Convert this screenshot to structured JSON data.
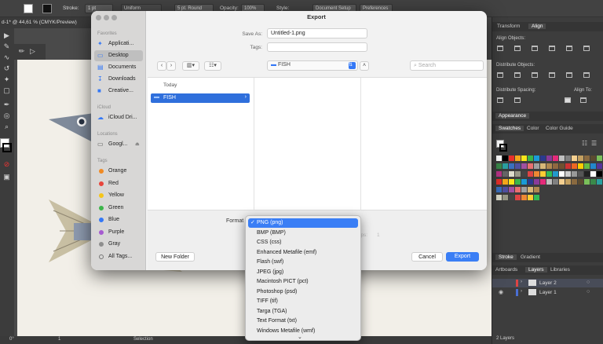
{
  "controlbar": {
    "stroke_label": "Stroke:",
    "stroke_value": "1 pt",
    "uniform": "Uniform",
    "brush": "5 pt. Round",
    "opacity_label": "Opacity:",
    "opacity_value": "100%",
    "style_label": "Style:",
    "doc_setup": "Document Setup",
    "preferences": "Preferences"
  },
  "doc_tab": "d-1* @ 44,61 % (CMYK/Preview)",
  "status": {
    "zoom": "0°",
    "page": "1",
    "mode": "Selection"
  },
  "panels": {
    "top_tabs": [
      "Transform",
      "Align"
    ],
    "align_objects": "Align Objects:",
    "distribute_objects": "Distribute Objects:",
    "distribute_spacing": "Distribute Spacing:",
    "align_to": "Align To:",
    "appearance": "Appearance",
    "swatch_tabs": [
      "Swatches",
      "Color",
      "Color Guide"
    ],
    "bottom_tabs": [
      "Stroke",
      "Gradient"
    ],
    "layer_tabs": [
      "Artboards",
      "Layers",
      "Libraries"
    ],
    "layers": [
      "Layer 2",
      "Layer 1"
    ],
    "layer_count": "2 Layers"
  },
  "dialog": {
    "title": "Export",
    "save_as_label": "Save As:",
    "save_as_value": "Untitled-1.png",
    "tags_label": "Tags:",
    "location": "FISH",
    "search_placeholder": "Search",
    "today": "Today",
    "folder": "FISH",
    "format_label": "Format",
    "ghost_label": "ips:",
    "ghost_value": "1",
    "new_folder": "New Folder",
    "cancel": "Cancel",
    "export": "Export",
    "sidebar": {
      "favorites": "Favorites",
      "icloud": "iCloud",
      "locations": "Locations",
      "tags": "Tags",
      "items": [
        "Applicati...",
        "Desktop",
        "Documents",
        "Downloads",
        "Creative..."
      ],
      "icloud_items": [
        "iCloud Dri..."
      ],
      "location_items": [
        "Googl..."
      ],
      "tag_items": [
        "Orange",
        "Red",
        "Yellow",
        "Green",
        "Blue",
        "Purple",
        "Gray",
        "All Tags..."
      ]
    }
  },
  "format_menu": {
    "items": [
      "PNG (png)",
      "BMP (BMP)",
      "CSS (css)",
      "Enhanced Metafile (emf)",
      "Flash (swf)",
      "JPEG (jpg)",
      "Macintosh PICT (pct)",
      "Photoshop (psd)",
      "TIFF (tif)",
      "Targa (TGA)",
      "Text Format (txt)",
      "Windows Metafile (wmf)"
    ],
    "selected": "PNG (png)"
  },
  "colors": {
    "accent": "#3a7ef5",
    "tags": [
      "#f08a24",
      "#e8453c",
      "#f5c518",
      "#3cb54a",
      "#3478f6",
      "#a65bd0",
      "#8e8e8e"
    ]
  }
}
